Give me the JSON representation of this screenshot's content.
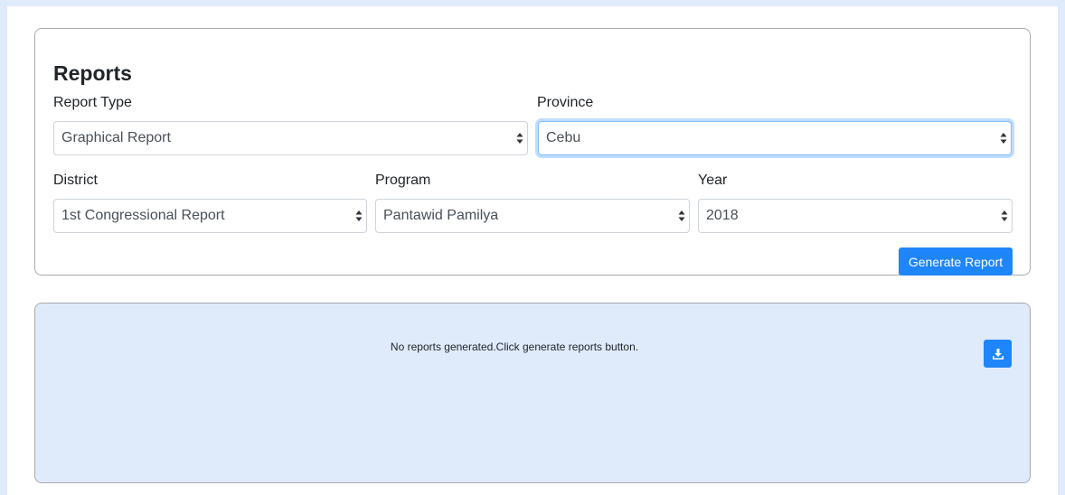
{
  "form": {
    "title": "Reports",
    "report_type": {
      "label": "Report Type",
      "value": "Graphical Report"
    },
    "province": {
      "label": "Province",
      "value": "Cebu"
    },
    "district": {
      "label": "District",
      "value": "1st Congressional Report"
    },
    "program": {
      "label": "Program",
      "value": "Pantawid Pamilya"
    },
    "year": {
      "label": "Year",
      "value": "2018"
    },
    "generate_label": "Generate Report"
  },
  "result": {
    "empty_message": "No reports generated.Click generate reports button.",
    "download_icon": "download-icon"
  },
  "colors": {
    "page_bg": "#dfeafb",
    "primary": "#1f86f9",
    "focus_border": "#80bdff"
  }
}
